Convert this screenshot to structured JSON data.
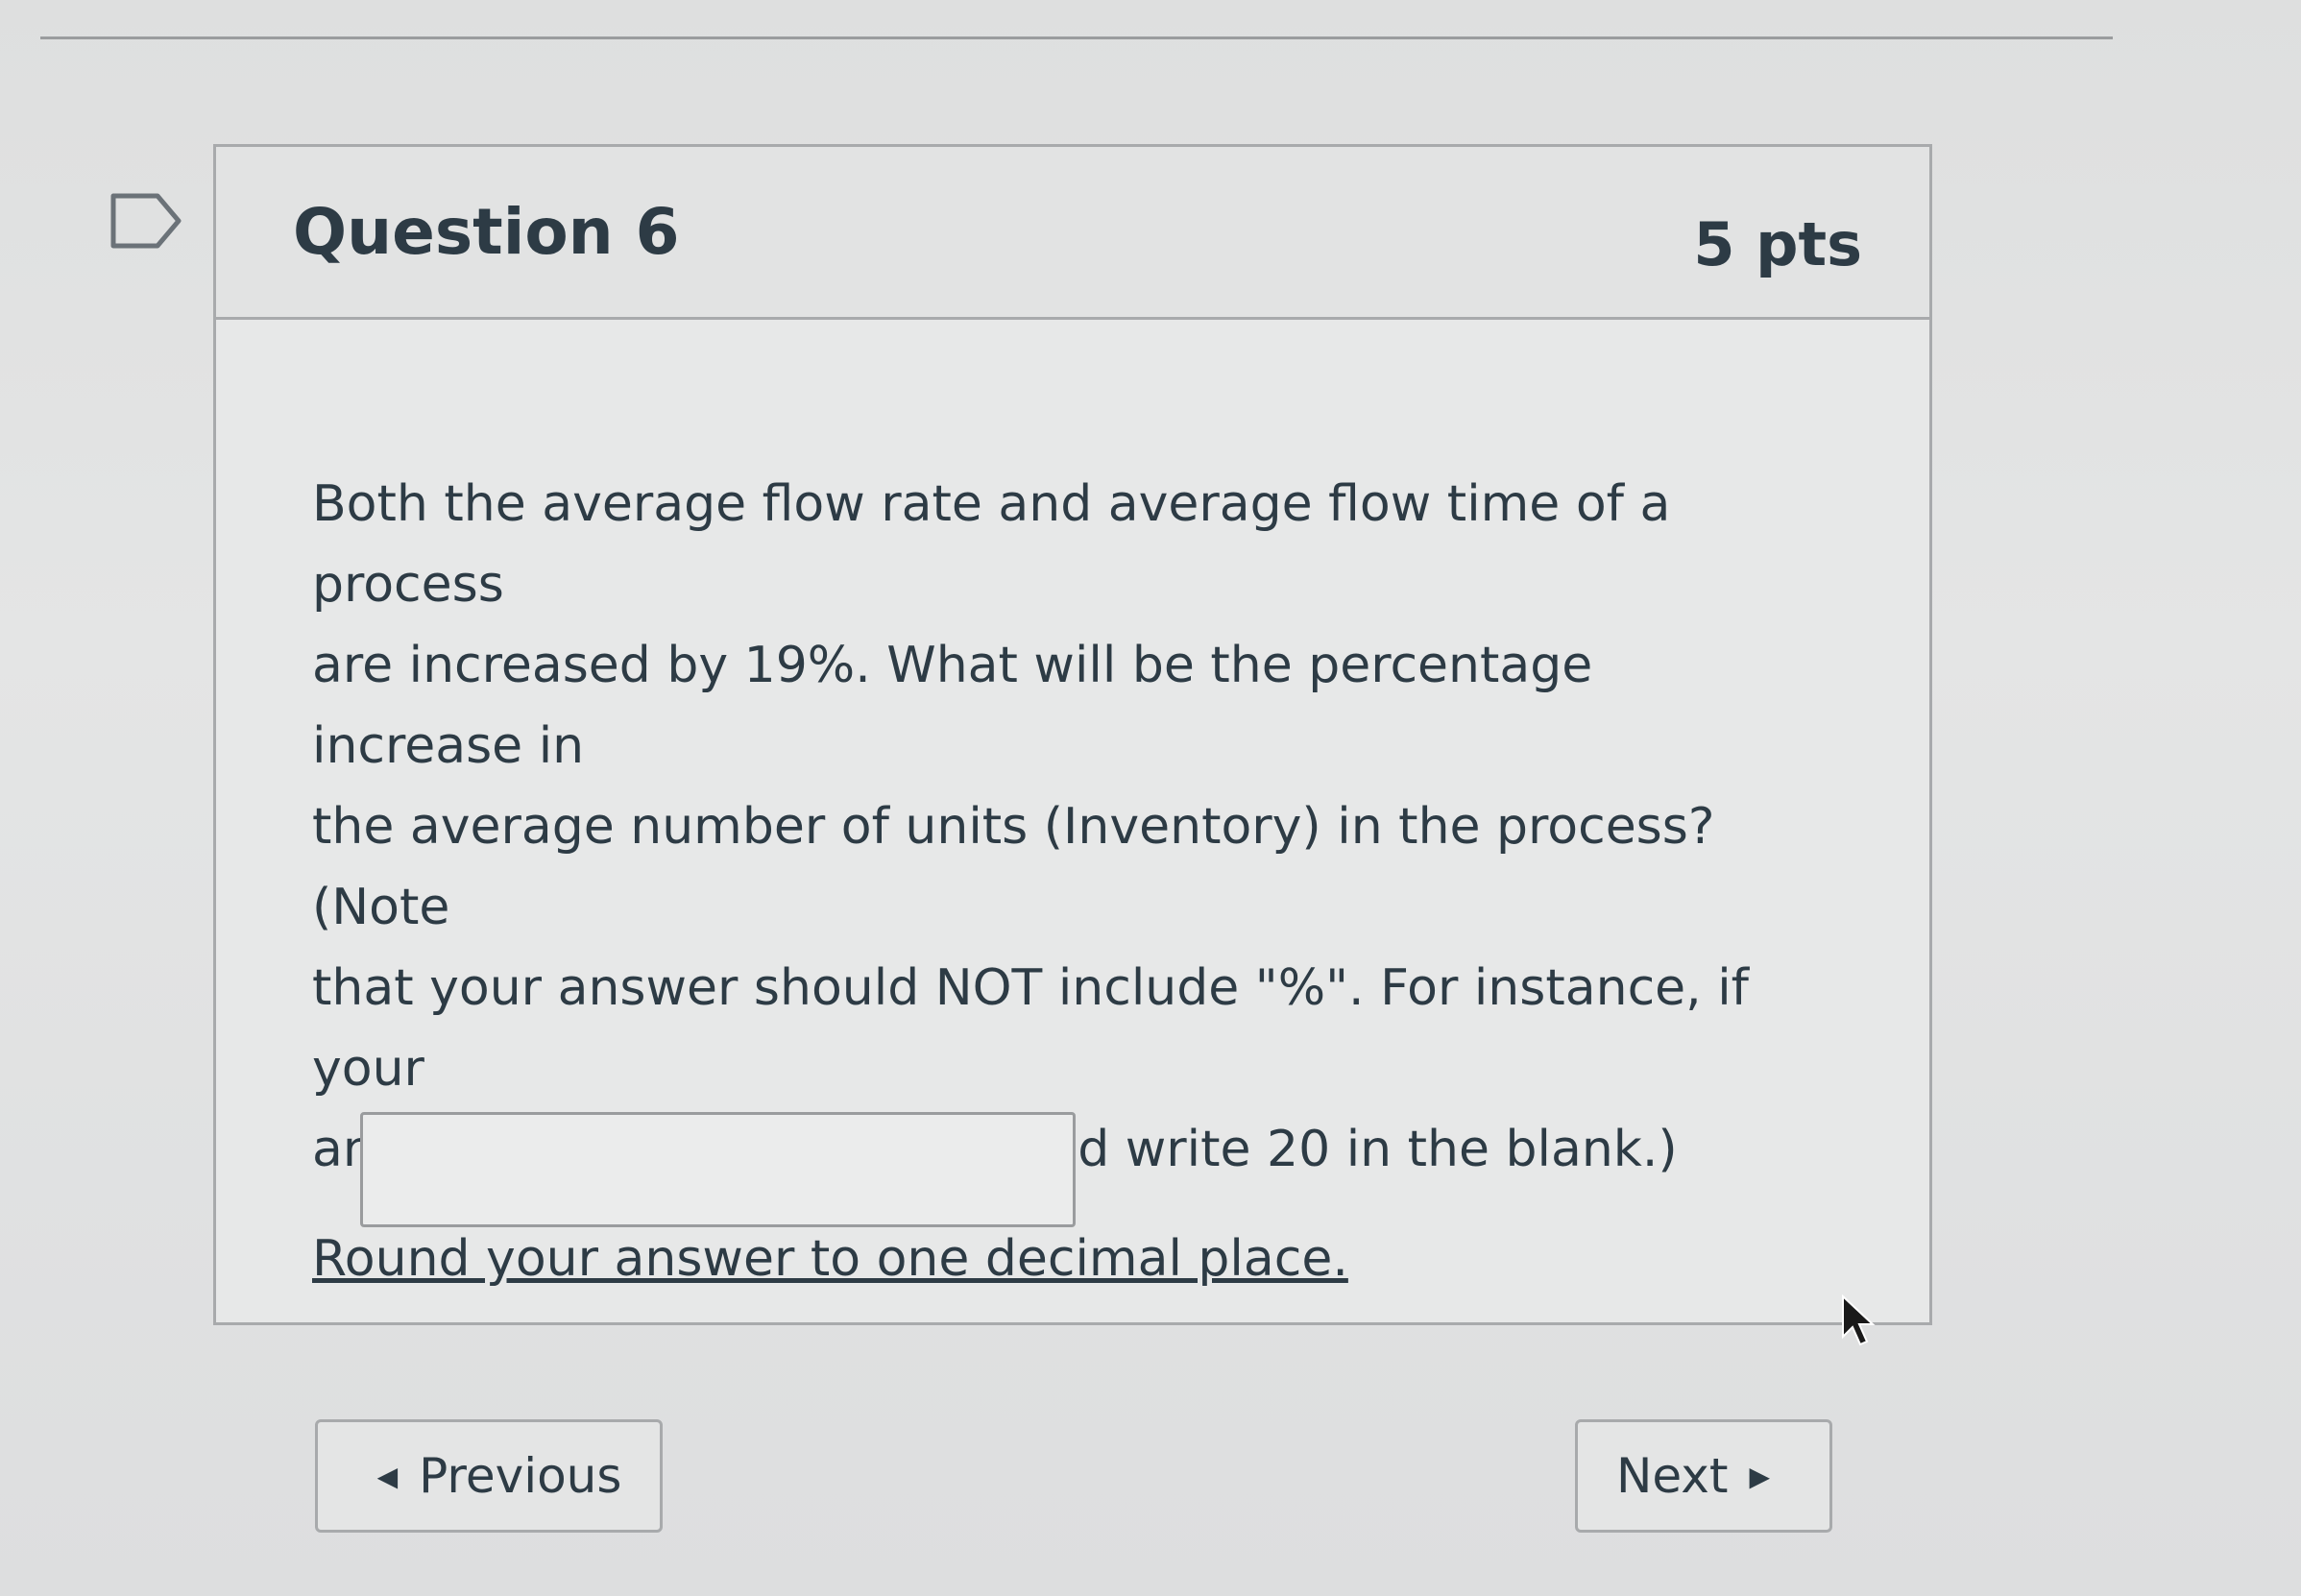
{
  "question": {
    "title": "Question 6",
    "points": "5 pts",
    "body": [
      "Both the average flow rate and average flow time of a process",
      "are increased by 19%. What will be the percentage increase in",
      "the average number of units (Inventory) in the process? (Note",
      "that your answer should NOT include \"%\". For instance, if your",
      "answer is 20%, then you should write 20 in the blank.)"
    ],
    "instruction": "Round your answer to one decimal place.",
    "answer_value": ""
  },
  "navigation": {
    "previous_label": "Previous",
    "next_label": "Next"
  },
  "icons": {
    "flag": "flag-icon",
    "prev_arrow": "triangle-left-icon",
    "next_arrow": "triangle-right-icon",
    "cursor": "mouse-pointer-icon"
  }
}
